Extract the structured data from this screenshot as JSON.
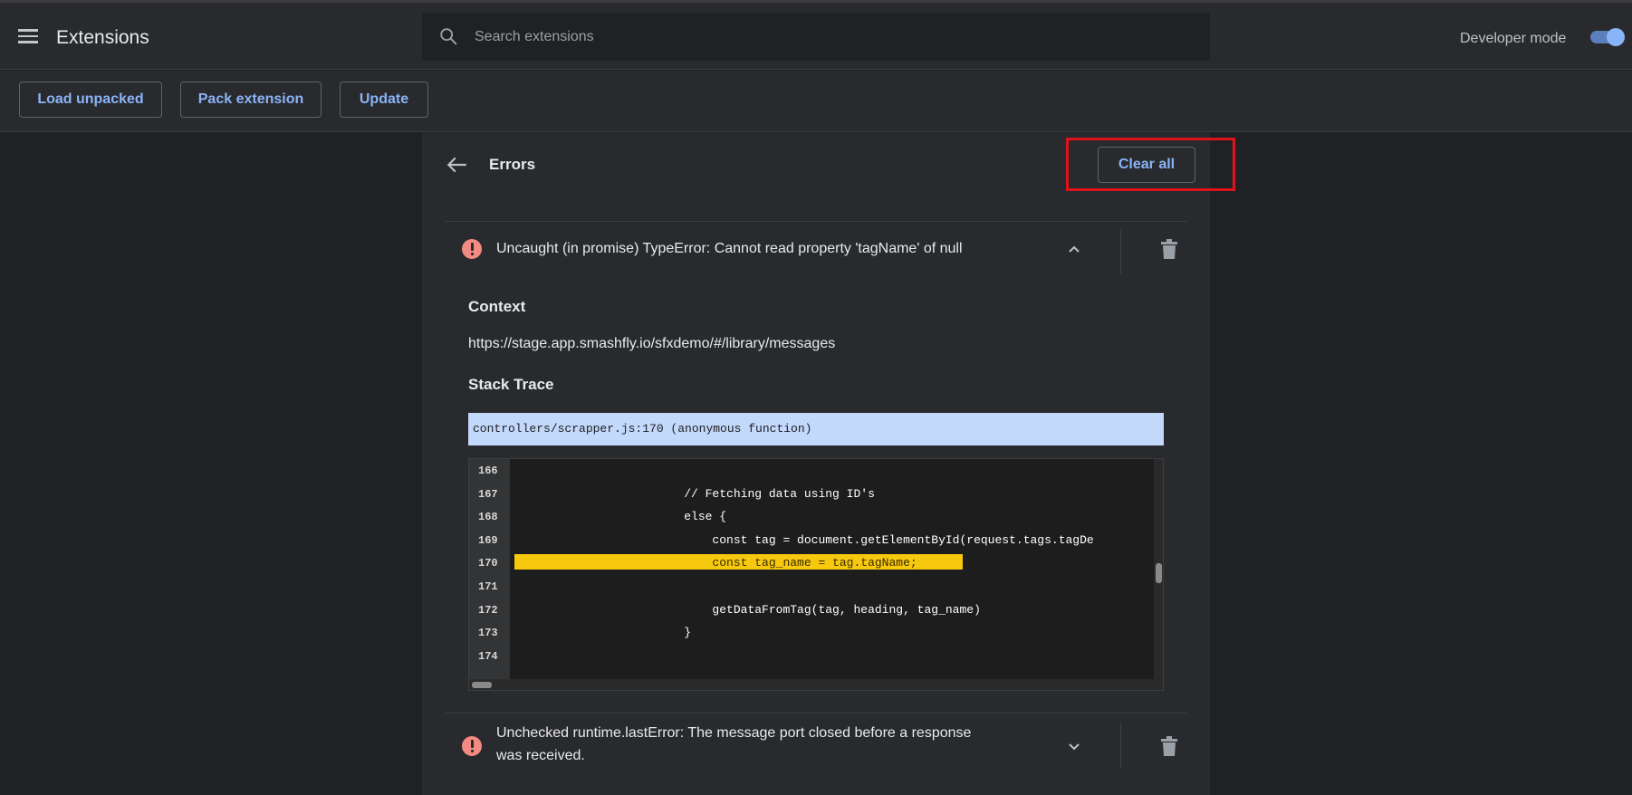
{
  "header": {
    "title": "Extensions",
    "search_placeholder": "Search extensions",
    "developer_mode_label": "Developer mode",
    "developer_mode_on": true
  },
  "toolbar": {
    "load_unpacked": "Load unpacked",
    "pack_extension": "Pack extension",
    "update": "Update"
  },
  "errors_page": {
    "title": "Errors",
    "clear_all": "Clear all",
    "errors": [
      {
        "message": "Uncaught (in promise) TypeError: Cannot read property 'tagName' of null",
        "expanded": true,
        "context_label": "Context",
        "context_url": "https://stage.app.smashfly.io/sfxdemo/#/library/messages",
        "stack_trace_label": "Stack Trace",
        "stack_frame": "controllers/scrapper.js:170 (anonymous function)",
        "code_lines": [
          {
            "num": "166",
            "code": ""
          },
          {
            "num": "167",
            "code": "                        // Fetching data using ID's"
          },
          {
            "num": "168",
            "code": "                        else {"
          },
          {
            "num": "169",
            "code": "                            const tag = document.getElementById(request.tags.tagDe"
          },
          {
            "num": "170",
            "code": "                            const tag_name = tag.tagName;"
          },
          {
            "num": "171",
            "code": ""
          },
          {
            "num": "172",
            "code": "                            getDataFromTag(tag, heading, tag_name)"
          },
          {
            "num": "173",
            "code": "                        }"
          },
          {
            "num": "174",
            "code": ""
          }
        ],
        "highlighted_line": "170"
      },
      {
        "message_line1": "Unchecked runtime.lastError: The message port closed before a response",
        "message_line2": "was received.",
        "expanded": false
      }
    ]
  },
  "colors": {
    "accent": "#8ab4f8",
    "error": "#f28b82",
    "highlight": "#f6c90e",
    "annotation": "#e1131a"
  }
}
